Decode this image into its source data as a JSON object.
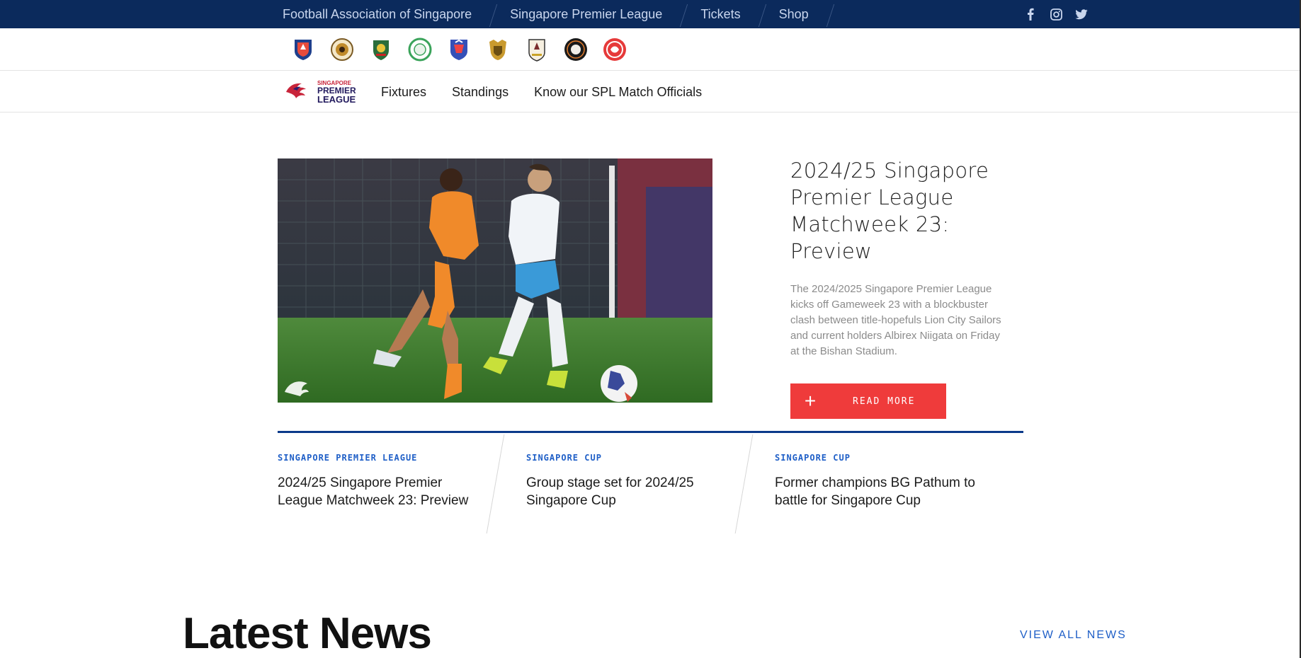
{
  "topbar": {
    "links": [
      {
        "label": "Football Association of Singapore"
      },
      {
        "label": "Singapore Premier League"
      },
      {
        "label": "Tickets"
      },
      {
        "label": "Shop"
      }
    ],
    "social": [
      "facebook-icon",
      "instagram-icon",
      "twitter-icon"
    ]
  },
  "clubs": {
    "crests": [
      {
        "icon": "albirex-crest-icon",
        "color": "#1e3f8c"
      },
      {
        "icon": "balestier-crest-icon",
        "color": "#c08a2b"
      },
      {
        "icon": "geylang-crest-icon",
        "color": "#2a6d3a"
      },
      {
        "icon": "hougang-crest-icon",
        "color": "#3aa35a"
      },
      {
        "icon": "lioncity-crest-icon",
        "color": "#3450b8"
      },
      {
        "icon": "tampines-crest-icon",
        "color": "#c99a2e"
      },
      {
        "icon": "tanjong-pagar-crest-icon",
        "color": "#7a2b2b"
      },
      {
        "icon": "young-lions-crest-icon",
        "color": "#1a1a1a"
      },
      {
        "icon": "brunei-dpmm-crest-icon",
        "color": "#e63a3a"
      }
    ]
  },
  "nav": {
    "logo_lines": [
      "SINGAPORE",
      "PREMIER",
      "LEAGUE"
    ],
    "items": [
      {
        "label": "Fixtures"
      },
      {
        "label": "Standings"
      },
      {
        "label": "Know our SPL Match Officials"
      }
    ]
  },
  "hero": {
    "title": "2024/25 Singapore Premier League Matchweek 23: Preview",
    "description": "The 2024/2025 Singapore Premier League kicks off Gameweek 23 with a blockbuster clash between title-hopefuls Lion City Sailors and current holders Albirex Niigata on Friday at the Bishan Stadium.",
    "read_more": "READ MORE",
    "accent": "#ef3b3b"
  },
  "related": [
    {
      "category": "SINGAPORE PREMIER LEAGUE",
      "title": "2024/25 Singapore Premier League Matchweek 23: Preview"
    },
    {
      "category": "SINGAPORE CUP",
      "title": "Group stage set for 2024/25 Singapore Cup"
    },
    {
      "category": "SINGAPORE CUP",
      "title": "Former champions BG Pathum to battle for Singapore Cup"
    }
  ],
  "latest": {
    "heading": "Latest News",
    "view_all": "VIEW ALL NEWS"
  },
  "colors": {
    "topbar": "#0b2a5c",
    "link_blue": "#1f5fc7",
    "divider_blue": "#0b3a8a"
  }
}
